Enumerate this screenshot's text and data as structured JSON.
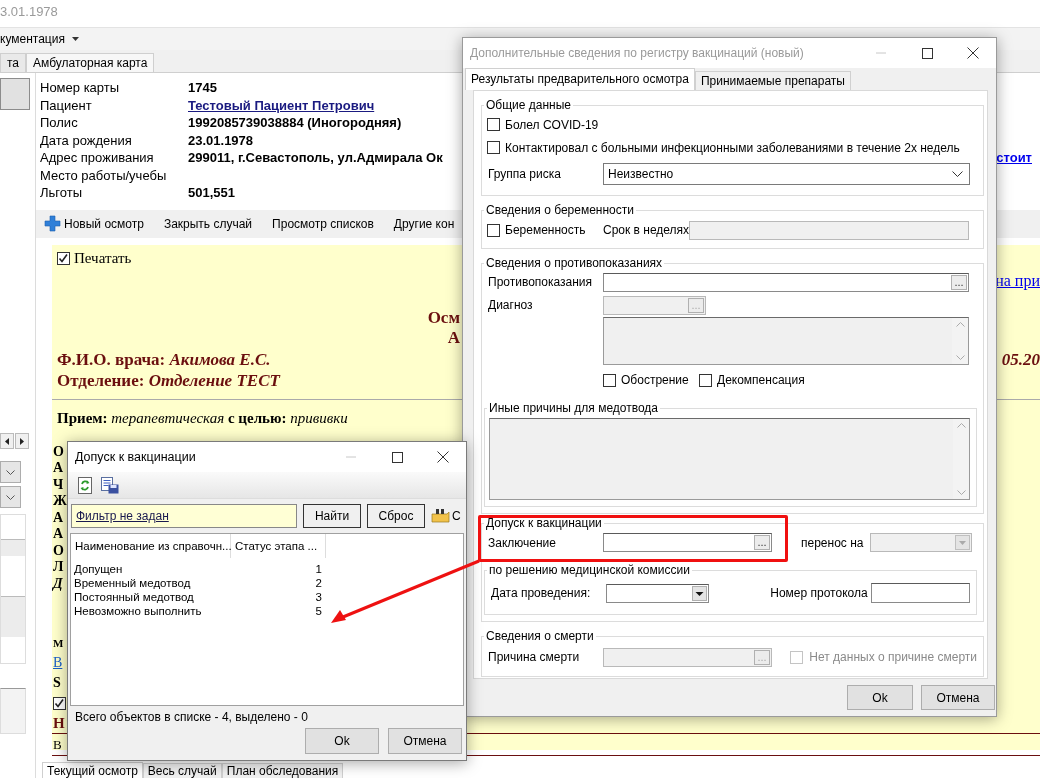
{
  "window": {
    "title": "3.01.1978"
  },
  "menu": {
    "label": "кументация"
  },
  "tabs": [
    {
      "label": "та",
      "selected": false
    },
    {
      "label": "Амбулаторная карта",
      "selected": true
    }
  ],
  "patient": [
    {
      "label": "Номер карты",
      "value": "1745",
      "kind": "text"
    },
    {
      "label": "Пациент",
      "value": "Тестовый Пациент Петрович",
      "kind": "link"
    },
    {
      "label": "Полис",
      "value": "1992085739038884 (Иногородняя)",
      "kind": "text"
    },
    {
      "label": "Дата рождения",
      "value": "23.01.1978",
      "kind": "text"
    },
    {
      "label": "Адрес проживания",
      "value": "299011, г.Севастополь, ул.Адмирала Ок",
      "kind": "text"
    },
    {
      "label": "Место работы/учебы",
      "kind": "text"
    },
    {
      "label": "Льготы",
      "value": "501,551",
      "kind": "text"
    }
  ],
  "side_link": "стоит",
  "toolbar": [
    {
      "label": "Новый осмотр",
      "kind": "add"
    },
    {
      "label": "Закрыть случай",
      "kind": "plain"
    },
    {
      "label": "Просмотр списков",
      "kind": "plain"
    },
    {
      "label": "Другие кон",
      "kind": "plain"
    }
  ],
  "document": {
    "print": {
      "label": "Печатать",
      "checked": true
    },
    "right_link": "на при",
    "title_fragments": [
      "Осм",
      "А"
    ],
    "doctor": "Ф.И.О. врача: *Акимова Е.С.*",
    "date_fragment": "05.20",
    "department": "Отделение: *Отделение ТЕСТ*",
    "reception": "**Прием:** *терапевтическая* **с целью:** *прививки*",
    "fragments": [
      {
        "text": "О",
        "kind": "bold"
      },
      {
        "text": "А",
        "kind": "bold"
      },
      {
        "text": "Ч",
        "kind": "bold"
      },
      {
        "text": "Ж",
        "kind": "bold"
      },
      {
        "text": "А",
        "kind": "bold"
      },
      {
        "text": "А",
        "kind": "bold"
      },
      {
        "text": "О",
        "kind": "bold"
      },
      {
        "text": "Л",
        "kind": "bold"
      },
      {
        "text": "Д",
        "kind": "italic-link"
      },
      {
        "text": "М",
        "kind": "small"
      },
      {
        "text": "В",
        "kind": "link"
      },
      {
        "text": "S",
        "kind": "bold-line"
      },
      {
        "kind": "checkbox",
        "checked": true
      },
      {
        "text": "Н",
        "kind": "heading"
      },
      {
        "text": "В",
        "kind": "bar"
      }
    ]
  },
  "bottom_tabs": [
    {
      "label": "Текущий осмотр",
      "selected": true
    },
    {
      "label": "Весь случай",
      "selected": false
    },
    {
      "label": "План обследования",
      "selected": false
    }
  ],
  "register_dialog": {
    "title": "Дополнительные сведения по регистру вакцинаций (новый)",
    "tabs": [
      {
        "label": "Результаты предварительного осмотра",
        "selected": true
      },
      {
        "label": "Принимаемые препараты",
        "selected": false
      }
    ],
    "general": {
      "title": "Общие данные",
      "checks": [
        {
          "label": "Болел COVID-19",
          "checked": false
        },
        {
          "label": "Контактировал с больными инфекционными заболеваниями в течение 2х недель",
          "checked": false
        }
      ],
      "risk": {
        "label": "Группа риска",
        "value": "Неизвестно"
      }
    },
    "pregnancy": {
      "title": "Сведения о беременности",
      "check": {
        "label": "Беременность",
        "checked": false
      },
      "weeks": {
        "label": "Срок в неделях",
        "disabled": true
      }
    },
    "contraindications": {
      "title": "Сведения о противопоказаниях",
      "field": {
        "label": "Противопоказания",
        "button": "...",
        "disabled": false
      },
      "diagnosis": {
        "label": "Диагноз",
        "button": "...",
        "disabled": true
      },
      "notes": {
        "disabled": true
      },
      "checks": [
        {
          "label": "Обострение",
          "checked": false
        },
        {
          "label": "Декомпенсация",
          "checked": false
        }
      ],
      "other": {
        "title": "Иные причины для медотвода",
        "disabled": true
      }
    },
    "admission": {
      "title": "Допуск к вакцинации",
      "conclusion": {
        "label": "Заключение",
        "button": "...",
        "disabled": false
      },
      "postpone": {
        "label": "перенос на",
        "disabled": true
      },
      "commission": {
        "title": "по решению медицинской комиссии",
        "date": {
          "label": "Дата проведения:"
        },
        "protocol": {
          "label": "Номер протокола"
        }
      }
    },
    "death": {
      "title": "Сведения о смерти",
      "cause": {
        "label": "Причина смерти",
        "button": "...",
        "disabled": true
      },
      "no_data": {
        "label": "Нет данных о причине смерти",
        "checked": false,
        "disabled": true
      }
    },
    "buttons": [
      "Ok",
      "Отмена"
    ]
  },
  "admission_dialog": {
    "title": "Допуск к вакцинации",
    "filter": "Фильтр не задан",
    "filter_buttons": [
      "Найти",
      "Сброс"
    ],
    "extra": "С",
    "columns": [
      "Наименование из справочн...",
      "Статус этапа ..."
    ],
    "rows": [
      {
        "name": "Допущен",
        "status": "1",
        "selected": false
      },
      {
        "name": "Временный медотвод",
        "status": "2",
        "selected": false
      },
      {
        "name": "Постоянный медотвод",
        "status": "3",
        "selected": false
      },
      {
        "name": "Невозможно выполнить",
        "status": "5",
        "selected": false
      }
    ],
    "status": "Всего объектов в списке - 4, выделено - 0",
    "buttons": [
      "Ok",
      "Отмена"
    ]
  }
}
